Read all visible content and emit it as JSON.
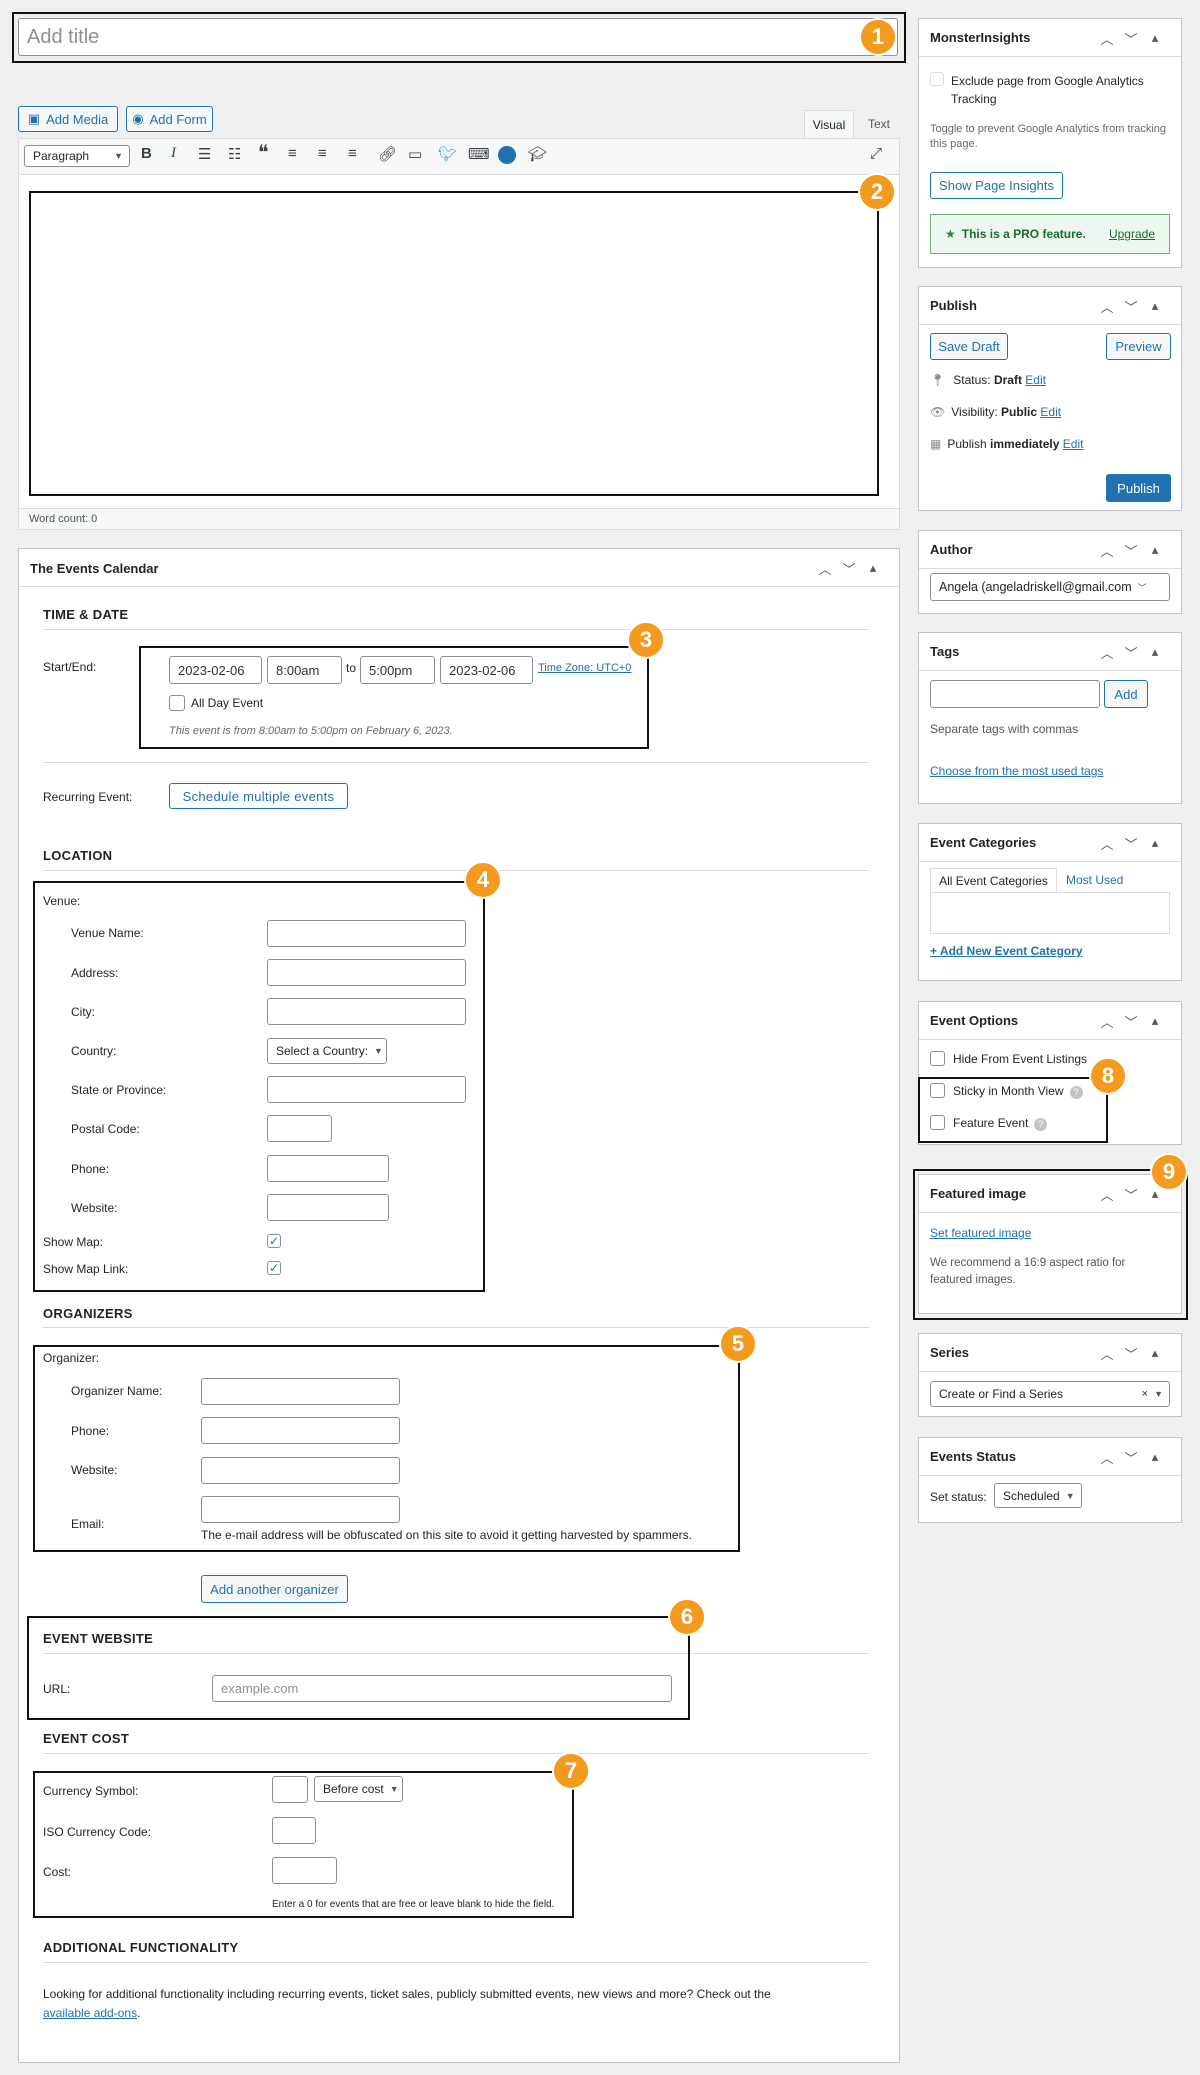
{
  "title_placeholder": "Add title",
  "editor": {
    "add_media": "Add Media",
    "add_form": "Add Form",
    "tab_visual": "Visual",
    "tab_text": "Text",
    "format": "Paragraph",
    "word_count": "Word count: 0"
  },
  "badges": [
    "1",
    "2",
    "3",
    "4",
    "5",
    "6",
    "7",
    "8",
    "9"
  ],
  "events_calendar": {
    "title": "The Events Calendar",
    "time_date": {
      "heading": "TIME & DATE",
      "label": "Start/End:",
      "start_date": "2023-02-06",
      "start_time": "8:00am",
      "to": "to",
      "end_time": "5:00pm",
      "end_date": "2023-02-06",
      "timezone": "Time Zone: UTC+0",
      "all_day": "All Day Event",
      "summary": "This event is from 8:00am to 5:00pm on February 6, 2023."
    },
    "recurring": {
      "label": "Recurring Event:",
      "button": "Schedule multiple events"
    },
    "location": {
      "heading": "LOCATION",
      "venue": "Venue:",
      "fields": [
        "Venue Name:",
        "Address:",
        "City:",
        "Country:",
        "State or Province:",
        "Postal Code:",
        "Phone:",
        "Website:"
      ],
      "country_select": "Select a Country:",
      "show_map": "Show Map:",
      "show_map_link": "Show Map Link:"
    },
    "organizers": {
      "heading": "ORGANIZERS",
      "organizer": "Organizer:",
      "fields": [
        "Organizer Name:",
        "Phone:",
        "Website:",
        "Email:"
      ],
      "email_note": "The e-mail address will be obfuscated on this site to avoid it getting harvested by spammers.",
      "add_button": "Add another organizer"
    },
    "website": {
      "heading": "EVENT WEBSITE",
      "label": "URL:",
      "placeholder": "example.com"
    },
    "cost": {
      "heading": "EVENT COST",
      "currency_symbol": "Currency Symbol:",
      "position": "Before cost",
      "iso": "ISO Currency Code:",
      "cost": "Cost:",
      "note": "Enter a 0 for events that are free or leave blank to hide the field."
    },
    "additional": {
      "heading": "ADDITIONAL FUNCTIONALITY",
      "text": "Looking for additional functionality including recurring events, ticket sales, publicly submitted events, new views and more? Check out the",
      "link": "available add-ons",
      "period": "."
    }
  },
  "sidebar": {
    "monster": {
      "title": "MonsterInsights",
      "exclude": "Exclude page from Google Analytics Tracking",
      "toggle_text": "Toggle to prevent Google Analytics from tracking this page.",
      "button": "Show Page Insights",
      "pro": "This is a PRO feature.",
      "upgrade": "Upgrade"
    },
    "publish": {
      "title": "Publish",
      "save_draft": "Save Draft",
      "preview": "Preview",
      "status_label": "Status:",
      "status_value": "Draft",
      "visibility_label": "Visibility:",
      "visibility_value": "Public",
      "publish_label": "Publish",
      "publish_value": "immediately",
      "edit": "Edit",
      "publish_button": "Publish"
    },
    "author": {
      "title": "Author",
      "value": "Angela (angeladriskell@gmail.com"
    },
    "tags": {
      "title": "Tags",
      "add": "Add",
      "hint": "Separate tags with commas",
      "choose": "Choose from the most used tags"
    },
    "categories": {
      "title": "Event Categories",
      "tab_all": "All Event Categories",
      "tab_most": "Most Used",
      "add_new": "+ Add New Event Category"
    },
    "options": {
      "title": "Event Options",
      "hide": "Hide From Event Listings",
      "sticky": "Sticky in Month View",
      "feature": "Feature Event"
    },
    "featured": {
      "title": "Featured image",
      "set": "Set featured image",
      "note": "We recommend a 16:9 aspect ratio for featured images."
    },
    "series": {
      "title": "Series",
      "placeholder": "Create or Find a Series"
    },
    "status": {
      "title": "Events Status",
      "label": "Set status:",
      "value": "Scheduled"
    }
  }
}
